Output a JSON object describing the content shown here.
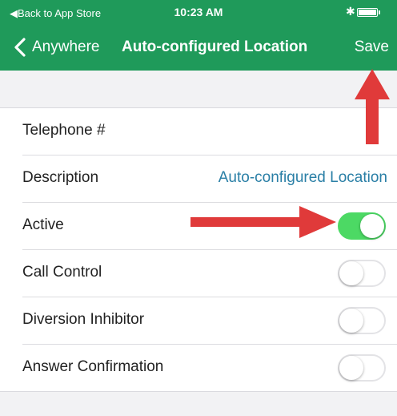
{
  "status_bar": {
    "back_label": "◀Back to App Store",
    "time": "10:23 AM",
    "bluetooth_icon": "bluetooth-icon",
    "battery_icon": "battery-icon"
  },
  "nav": {
    "back_label": "Anywhere",
    "title": "Auto-configured Location",
    "save_label": "Save"
  },
  "rows": [
    {
      "label": "Telephone #",
      "value": ""
    },
    {
      "label": "Description",
      "value": "Auto-configured Location"
    },
    {
      "label": "Active",
      "toggle": true
    },
    {
      "label": "Call Control",
      "toggle": false
    },
    {
      "label": "Diversion Inhibitor",
      "toggle": false
    },
    {
      "label": "Answer Confirmation",
      "toggle": false
    }
  ],
  "colors": {
    "header": "#1f9a5a",
    "toggle_on": "#4cd964",
    "value_text": "#2a7fa6",
    "annotation_arrow": "#e03a3a"
  }
}
